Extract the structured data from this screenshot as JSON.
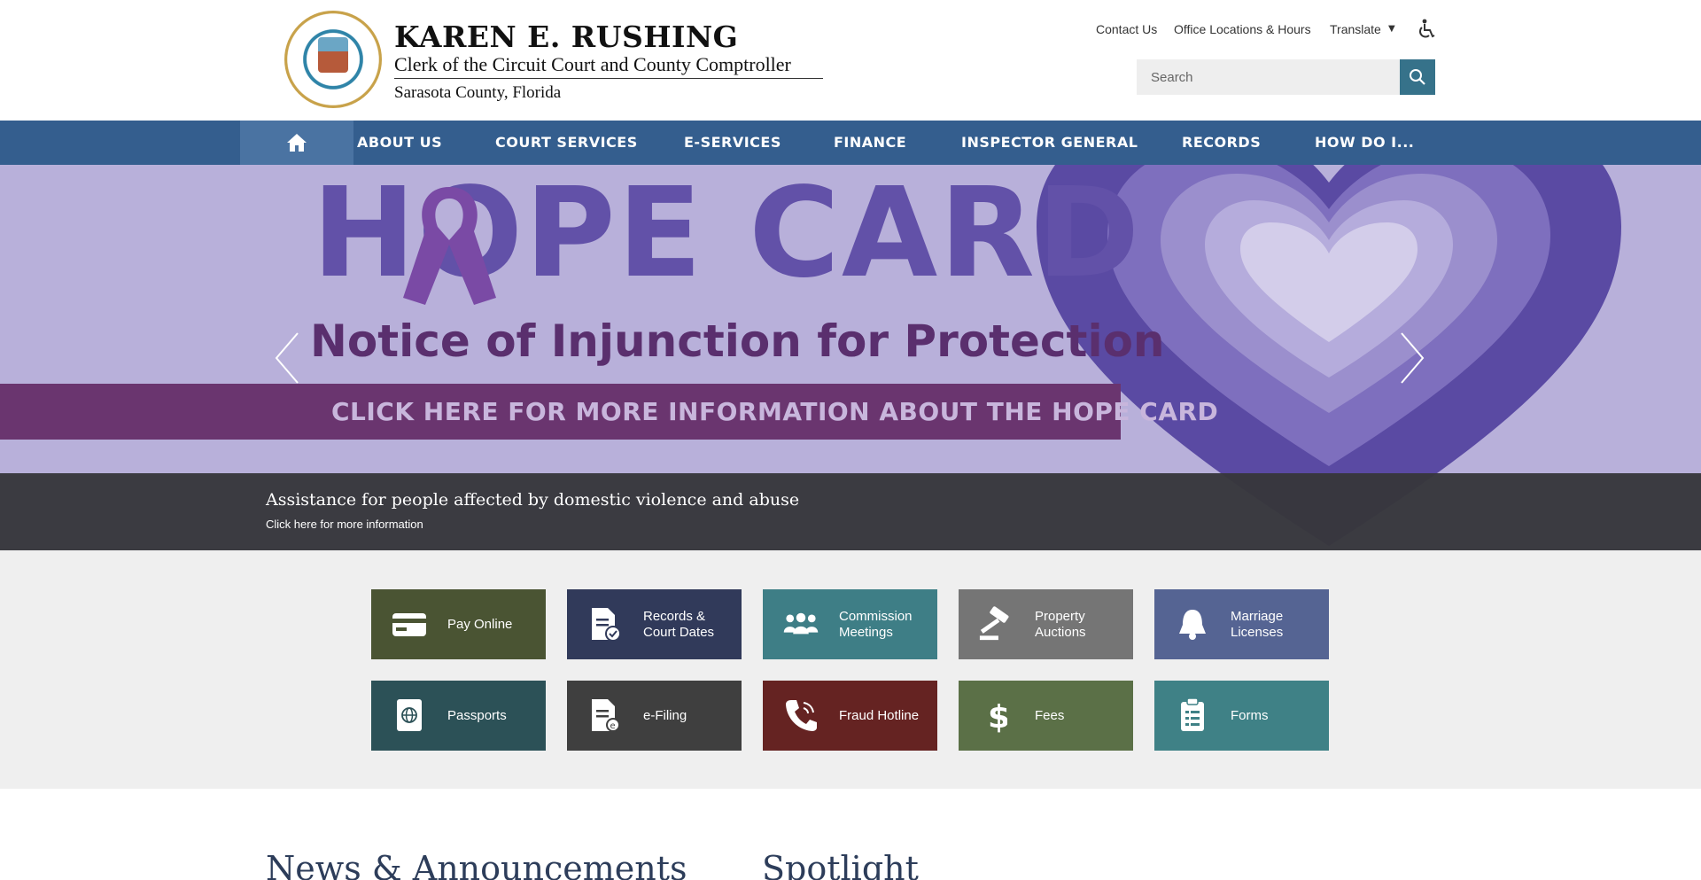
{
  "header": {
    "name": "KAREN E. RUSHING",
    "subtitle": "Clerk of the Circuit Court and County Comptroller",
    "county": "Sarasota County, Florida",
    "util_nav": {
      "contact": "Contact Us",
      "office": "Office Locations & Hours",
      "translate": "Translate",
      "caret": "▼"
    },
    "search": {
      "placeholder": "Search"
    }
  },
  "nav": {
    "items": [
      "ABOUT US",
      "COURT SERVICES",
      "E-SERVICES",
      "FINANCE",
      "INSPECTOR GENERAL",
      "RECORDS",
      "HOW DO I..."
    ]
  },
  "hero": {
    "title": "HOPE CARD",
    "subtitle": "Notice of Injunction for Protection",
    "cta": "CLICK HERE FOR MORE INFORMATION ABOUT THE HOPE CARD",
    "caption_title": "Assistance for people affected by domestic violence and abuse",
    "caption_link": "Click here for more information"
  },
  "tiles": [
    {
      "label": "Pay Online",
      "icon": "credit-card-icon",
      "color": "#4a5433"
    },
    {
      "label": "Records & Court Dates",
      "icon": "document-check-icon",
      "color": "#313a5a"
    },
    {
      "label": "Commission Meetings",
      "icon": "people-group-icon",
      "color": "#3e7e86"
    },
    {
      "label": "Property Auctions",
      "icon": "gavel-icon",
      "color": "#757575"
    },
    {
      "label": "Marriage Licenses",
      "icon": "bell-icon",
      "color": "#556493"
    },
    {
      "label": "Passports",
      "icon": "passport-icon",
      "color": "#2c5157"
    },
    {
      "label": "e-Filing",
      "icon": "efile-document-icon",
      "color": "#3f3f3f"
    },
    {
      "label": "Fraud Hotline",
      "icon": "phone-icon",
      "color": "#652322"
    },
    {
      "label": "Fees",
      "icon": "dollar-icon",
      "color": "#5b7047"
    },
    {
      "label": "Forms",
      "icon": "clipboard-icon",
      "color": "#3f8186"
    }
  ],
  "sections": {
    "news": "News & Announcements",
    "spotlight": "Spotlight"
  },
  "colors": {
    "nav_bg": "#345e8e",
    "hero_bg": "#b8b0da",
    "hope_purple": "#6251a8",
    "cta_bg": "#6a356f",
    "search_btn": "#36728a"
  }
}
